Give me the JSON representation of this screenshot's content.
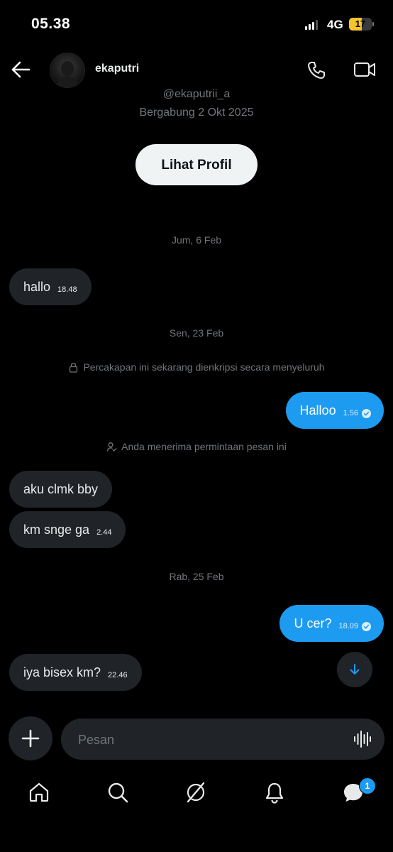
{
  "status_bar": {
    "time": "05.38",
    "network": "4G",
    "battery": "17"
  },
  "header": {
    "username": "ekaputri"
  },
  "profile": {
    "handle": "@ekaputrii_a",
    "joined": "Bergabung 2 Okt 2025",
    "view_profile_label": "Lihat Profil"
  },
  "messages": {
    "date_1": "Jum, 6 Feb",
    "msg_1": {
      "text": "hallo",
      "time": "18.48"
    },
    "date_2": "Sen, 23 Feb",
    "encryption_notice": "Percakapan ini sekarang dienkripsi secara menyeluruh",
    "msg_2": {
      "text": "Halloo",
      "time": "1.56"
    },
    "accepted_notice": "Anda menerima permintaan pesan ini",
    "msg_3": {
      "text": "aku clmk bby"
    },
    "msg_4": {
      "text": "km snge ga",
      "time": "2.44"
    },
    "date_3": "Rab, 25 Feb",
    "msg_5": {
      "text": "U cer?",
      "time": "18.09"
    },
    "msg_6": {
      "text": "iya bisex km?",
      "time": "22.46"
    }
  },
  "composer": {
    "placeholder": "Pesan"
  },
  "nav": {
    "messages_badge": "1"
  },
  "colors": {
    "accent": "#1d9bf0",
    "background": "#000000",
    "bubble_incoming": "#202327"
  }
}
